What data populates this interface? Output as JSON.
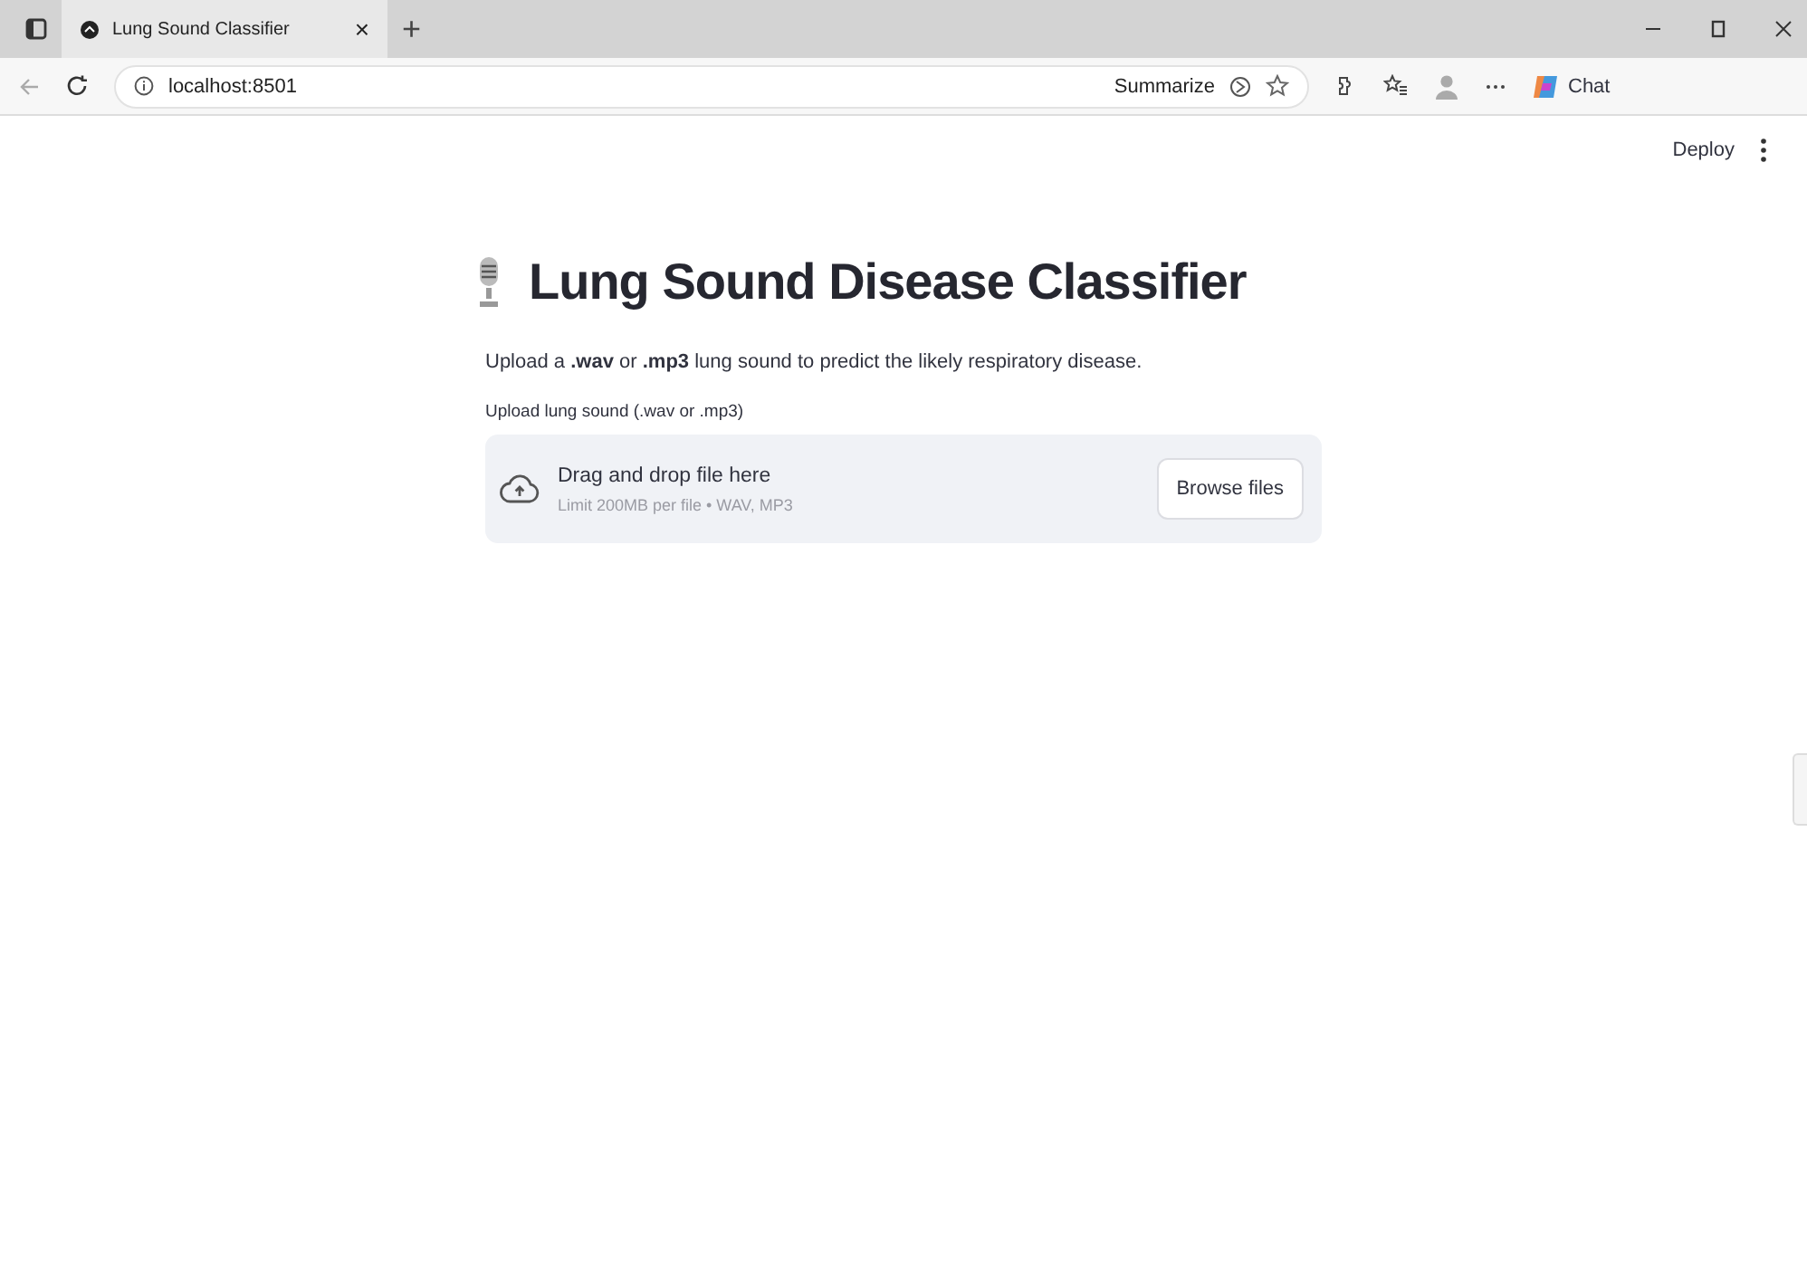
{
  "browser": {
    "tab": {
      "title": "Lung Sound Classifier",
      "close": "×",
      "selected": true
    },
    "new_tab": "+",
    "address": "localhost:8501",
    "summarize": "Summarize",
    "copilot": "Chat"
  },
  "app": {
    "deploy": "Deploy",
    "title": "Lung Sound Disease Classifier",
    "intro": "Upload a **.wav** or **.mp3** lung sound to predict the likely respiratory disease.",
    "uploader": {
      "label": "Upload lung sound (.wav or .mp3)",
      "prompt": "Drag and drop file here",
      "limit": "Limit 200MB per file • WAV, MP3",
      "button": "Browse files"
    }
  }
}
